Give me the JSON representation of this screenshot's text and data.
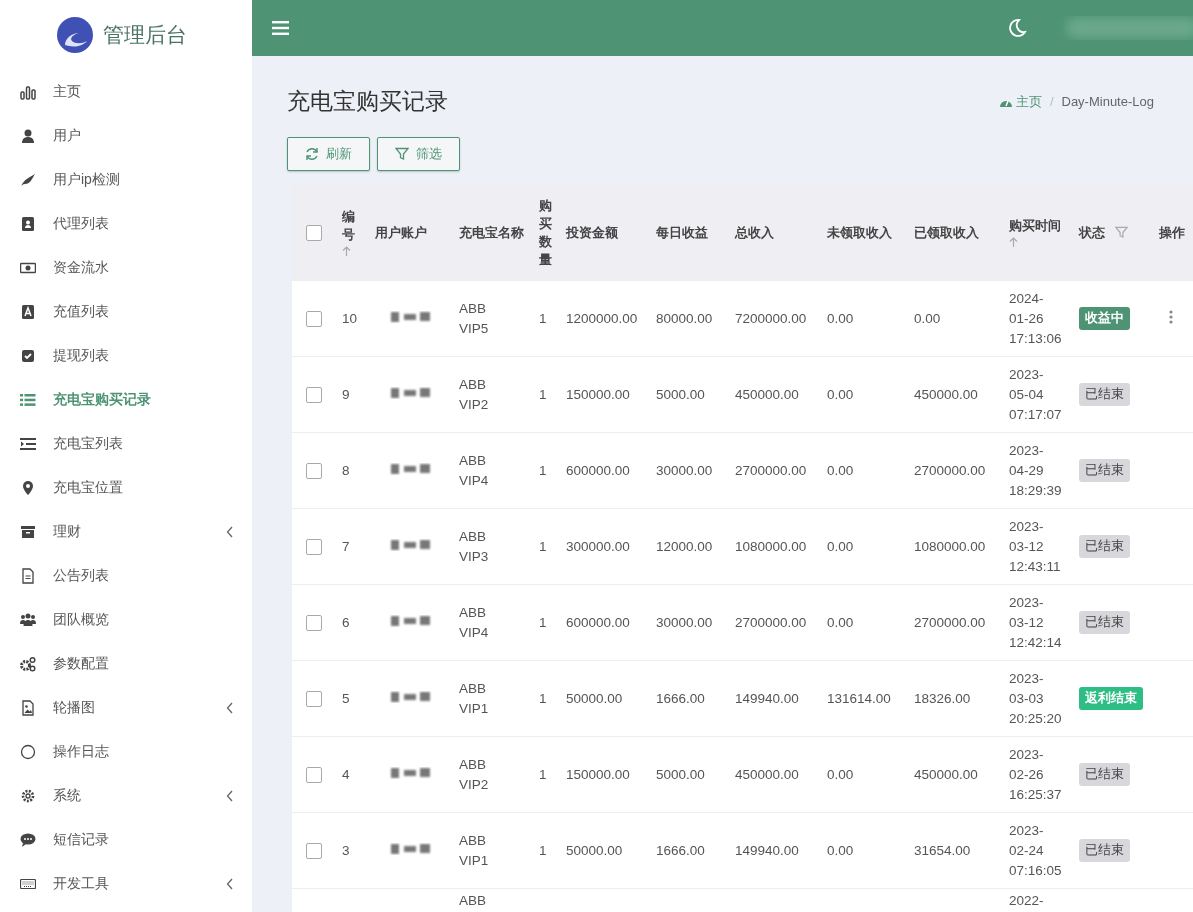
{
  "brand": {
    "title": "管理后台"
  },
  "sidebar": {
    "items": [
      {
        "label": "主页",
        "selected": false,
        "expandable": false
      },
      {
        "label": "用户",
        "selected": false,
        "expandable": false
      },
      {
        "label": "用户ip检测",
        "selected": false,
        "expandable": false
      },
      {
        "label": "代理列表",
        "selected": false,
        "expandable": false
      },
      {
        "label": "资金流水",
        "selected": false,
        "expandable": false
      },
      {
        "label": "充值列表",
        "selected": false,
        "expandable": false
      },
      {
        "label": "提现列表",
        "selected": false,
        "expandable": false
      },
      {
        "label": "充电宝购买记录",
        "selected": true,
        "expandable": false
      },
      {
        "label": "充电宝列表",
        "selected": false,
        "expandable": false
      },
      {
        "label": "充电宝位置",
        "selected": false,
        "expandable": false
      },
      {
        "label": "理财",
        "selected": false,
        "expandable": true
      },
      {
        "label": "公告列表",
        "selected": false,
        "expandable": false
      },
      {
        "label": "团队概览",
        "selected": false,
        "expandable": false
      },
      {
        "label": "参数配置",
        "selected": false,
        "expandable": false
      },
      {
        "label": "轮播图",
        "selected": false,
        "expandable": true
      },
      {
        "label": "操作日志",
        "selected": false,
        "expandable": false
      },
      {
        "label": "系统",
        "selected": false,
        "expandable": true
      },
      {
        "label": "短信记录",
        "selected": false,
        "expandable": false
      },
      {
        "label": "开发工具",
        "selected": false,
        "expandable": true
      }
    ]
  },
  "page": {
    "title": "充电宝购买记录",
    "breadcrumb": [
      {
        "label": "主页",
        "kind": "link"
      },
      {
        "label": "/",
        "kind": "separator"
      },
      {
        "label": "Day-Minute-Log",
        "kind": "current"
      }
    ]
  },
  "toolbar": {
    "buttons": [
      {
        "label": "刷新",
        "kind": "refresh"
      },
      {
        "label": "筛选",
        "kind": "filter"
      }
    ]
  },
  "table": {
    "all_checked": false,
    "columns": [
      {
        "label": "编号",
        "sortable": true
      },
      {
        "label": "用户账户"
      },
      {
        "label": "充电宝名称"
      },
      {
        "label": "购买数量"
      },
      {
        "label": "投资金额"
      },
      {
        "label": "每日收益"
      },
      {
        "label": "总收入"
      },
      {
        "label": "未领取收入"
      },
      {
        "label": "已领取收入"
      },
      {
        "label": "购买时间",
        "sortable": true
      },
      {
        "label": "状态",
        "filterable": true
      },
      {
        "label": "操作"
      }
    ],
    "rows": [
      {
        "checked": false,
        "id": "10",
        "name": "ABB VIP5",
        "qty": "1",
        "invest": "1200000.00",
        "daily": "80000.00",
        "total": "7200000.00",
        "unclaimed": "0.00",
        "claimed": "0.00",
        "time": "2024-01-26 17:13:06",
        "status": {
          "label": "收益中",
          "kind": "earning"
        },
        "menu": true
      },
      {
        "checked": false,
        "id": "9",
        "name": "ABB VIP2",
        "qty": "1",
        "invest": "150000.00",
        "daily": "5000.00",
        "total": "450000.00",
        "unclaimed": "0.00",
        "claimed": "450000.00",
        "time": "2023-05-04 07:17:07",
        "status": {
          "label": "已结束",
          "kind": "ended"
        }
      },
      {
        "checked": false,
        "id": "8",
        "name": "ABB VIP4",
        "qty": "1",
        "invest": "600000.00",
        "daily": "30000.00",
        "total": "2700000.00",
        "unclaimed": "0.00",
        "claimed": "2700000.00",
        "time": "2023-04-29 18:29:39",
        "status": {
          "label": "已结束",
          "kind": "ended"
        }
      },
      {
        "checked": false,
        "id": "7",
        "name": "ABB VIP3",
        "qty": "1",
        "invest": "300000.00",
        "daily": "12000.00",
        "total": "1080000.00",
        "unclaimed": "0.00",
        "claimed": "1080000.00",
        "time": "2023-03-12 12:43:11",
        "status": {
          "label": "已结束",
          "kind": "ended"
        }
      },
      {
        "checked": false,
        "id": "6",
        "name": "ABB VIP4",
        "qty": "1",
        "invest": "600000.00",
        "daily": "30000.00",
        "total": "2700000.00",
        "unclaimed": "0.00",
        "claimed": "2700000.00",
        "time": "2023-03-12 12:42:14",
        "status": {
          "label": "已结束",
          "kind": "ended"
        }
      },
      {
        "checked": false,
        "id": "5",
        "name": "ABB VIP1",
        "qty": "1",
        "invest": "50000.00",
        "daily": "1666.00",
        "total": "149940.00",
        "unclaimed": "131614.00",
        "claimed": "18326.00",
        "time": "2023-03-03 20:25:20",
        "status": {
          "label": "返利结束",
          "kind": "rebate"
        }
      },
      {
        "checked": false,
        "id": "4",
        "name": "ABB VIP2",
        "qty": "1",
        "invest": "150000.00",
        "daily": "5000.00",
        "total": "450000.00",
        "unclaimed": "0.00",
        "claimed": "450000.00",
        "time": "2023-02-26 16:25:37",
        "status": {
          "label": "已结束",
          "kind": "ended"
        }
      },
      {
        "checked": false,
        "id": "3",
        "name": "ABB VIP1",
        "qty": "1",
        "invest": "50000.00",
        "daily": "1666.00",
        "total": "149940.00",
        "unclaimed": "0.00",
        "claimed": "31654.00",
        "time": "2023-02-24 07:16:05",
        "status": {
          "label": "已结束",
          "kind": "ended"
        }
      },
      {
        "partial": true,
        "name": "ABB",
        "time": "2022-"
      }
    ]
  }
}
